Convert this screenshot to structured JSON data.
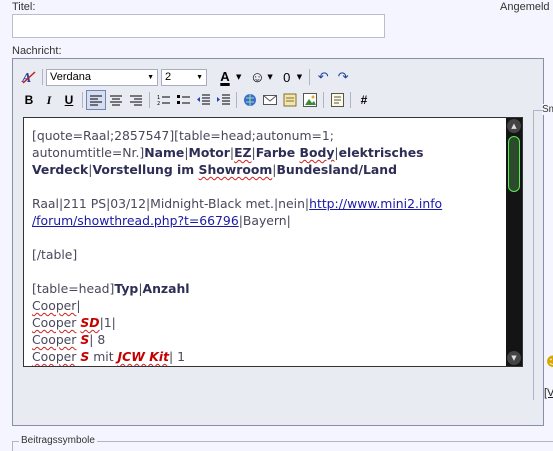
{
  "form": {
    "title_label": "Titel:",
    "angemeldet_label": "Angemeld",
    "title_value": "",
    "message_label": "Nachricht:",
    "symbols_label": "Beitragssymbole",
    "side_label": "Sm",
    "side_link": "[V"
  },
  "toolbar": {
    "font": "Verdana",
    "size": "2",
    "bold": "B",
    "italic": "I",
    "underline": "U",
    "font_color": "A",
    "hash": "#",
    "icons": [
      "switch-mode-icon",
      "font-color-icon",
      "smilie-icon",
      "attachment-icon",
      "undo-icon",
      "redo-icon",
      "bold-icon",
      "italic-icon",
      "underline-icon",
      "align-left-icon",
      "align-center-icon",
      "align-right-icon",
      "ordered-list-icon",
      "unordered-list-icon",
      "outdent-icon",
      "indent-icon",
      "insert-link-icon",
      "insert-email-icon",
      "insert-quote-icon",
      "insert-image-icon",
      "insert-code-icon",
      "insert-wrap-icon"
    ]
  },
  "editor": {
    "lines": [
      "[quote=Raal;2857547][table=head;autonum=1;",
      "autonumtitle=Nr.]Name|Motor|EZ|Farbe Body|elektrisches",
      "Verdeck|Vorstellung im Showroom|Bundesland/Land",
      "",
      "Raal|211 PS|03/12|Midnight-Black met.|nein|http://www.mini2.info",
      "/forum/showthread.php?t=66796|Bayern|",
      "",
      "[/table]",
      "",
      "[table=head]Typ|Anzahl",
      "Cooper|",
      "Cooper SD|1|",
      "Cooper S| 8",
      "Cooper S mit JCW Kit| 1"
    ]
  },
  "colors": {
    "background": "#f5f5ff",
    "panel": "#e9ebf3",
    "scrollbar_thumb_border": "#55ee55",
    "link": "#1a1aa6",
    "highlight_red": "#c40000"
  }
}
